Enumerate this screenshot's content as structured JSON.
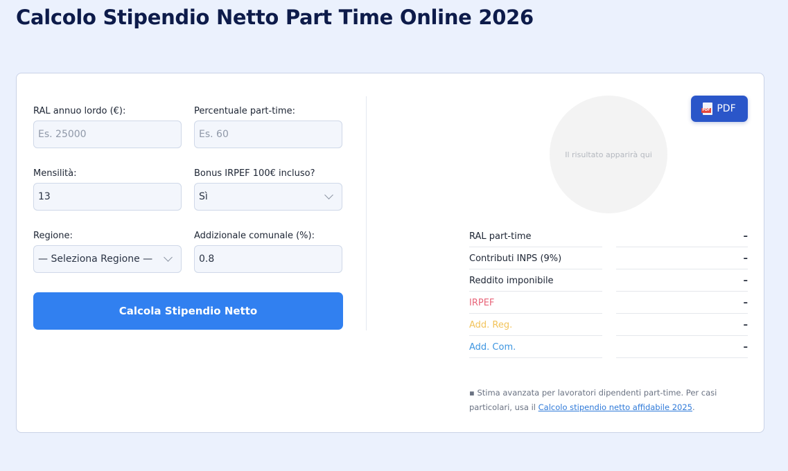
{
  "page": {
    "title": "Calcolo Stipendio Netto Part Time Online 2026"
  },
  "form": {
    "ral": {
      "label": "RAL annuo lordo (€):",
      "placeholder": "Es. 25000",
      "value": ""
    },
    "parttime": {
      "label": "Percentuale part-time:",
      "placeholder": "Es. 60",
      "value": ""
    },
    "mensilita": {
      "label": "Mensilità:",
      "value": "13"
    },
    "bonus": {
      "label": "Bonus IRPEF 100€ incluso?",
      "value": "Sì"
    },
    "regione": {
      "label": "Regione:",
      "value": "— Seleziona Regione —"
    },
    "addcom": {
      "label": "Addizionale comunale (%):",
      "value": "0.8"
    },
    "calc_button": "Calcola Stipendio Netto"
  },
  "result": {
    "pdf_button": "PDF",
    "pdf_icon": "pdf-file-icon",
    "placeholder": "Il risultato apparirà qui",
    "rows": [
      {
        "label": "RAL part-time",
        "value": "–",
        "color": "#1c2433"
      },
      {
        "label": "Contributi INPS (9%)",
        "value": "–",
        "color": "#1c2433"
      },
      {
        "label": "Reddito imponibile",
        "value": "–",
        "color": "#1c2433"
      },
      {
        "label": "IRPEF",
        "value": "–",
        "color": "#e8657a"
      },
      {
        "label": "Add. Reg.",
        "value": "–",
        "color": "#f2c35a"
      },
      {
        "label": "Add. Com.",
        "value": "–",
        "color": "#3d95e0"
      }
    ]
  },
  "note": {
    "bullet": "▪",
    "text": "Stima avanzata per lavoratori dipendenti part-time. Per casi particolari, usa il",
    "link": "Calcolo stipendio netto affidabile 2025",
    "suffix": "."
  },
  "colors": {
    "accent": "#3180f0",
    "pdf": "#2a56c9",
    "background": "#ebf1fd"
  }
}
